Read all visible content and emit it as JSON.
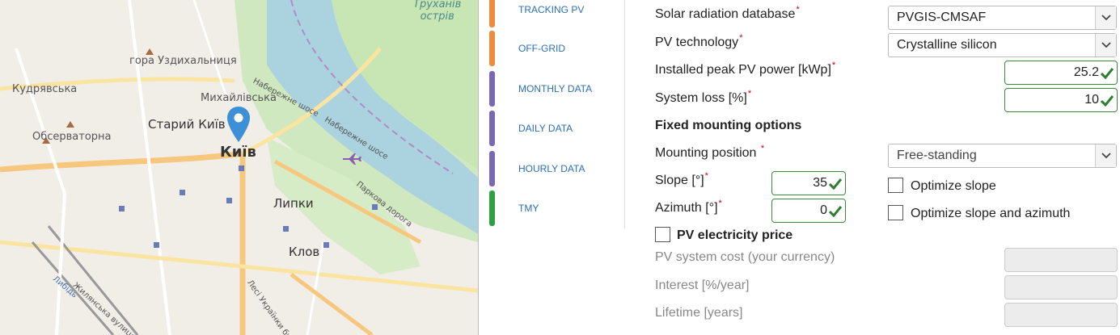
{
  "map": {
    "labels": {
      "trukhaniv": "Труханів\nострів",
      "uzdykhalnytsia": "гора Уздихальниця",
      "kudriavska": "Кудрявська",
      "mykhailivska": "Михайлівська",
      "naberezhne1": "Набережне шосе",
      "naberezhne2": "Набережне шосе",
      "staryi_kyiv": "Старий Київ",
      "observatorna": "Обсерваторна",
      "kyiv": "Київ",
      "lypky": "Липки",
      "parkova": "Паркова дорога",
      "klov": "Клов",
      "lybid": "Либідь",
      "zhylianska": "Жилянська вулиця",
      "lesi": "Лесі Українки бул."
    }
  },
  "tabs": [
    {
      "label": "TRACKING PV",
      "color": "#f08a3c"
    },
    {
      "label": "OFF-GRID",
      "color": "#f08a3c"
    },
    {
      "label": "MONTHLY DATA",
      "color": "#7b68b5"
    },
    {
      "label": "DAILY DATA",
      "color": "#7b68b5"
    },
    {
      "label": "HOURLY DATA",
      "color": "#7b68b5"
    },
    {
      "label": "TMY",
      "color": "#2ea043"
    }
  ],
  "form": {
    "required_mark": "*",
    "solar_db": {
      "label": "Solar radiation database",
      "value": "PVGIS-CMSAF"
    },
    "pv_tech": {
      "label": "PV technology",
      "value": "Crystalline silicon"
    },
    "peak_power": {
      "label": "Installed peak PV power [kWp]",
      "value": "25.2"
    },
    "system_loss": {
      "label": "System loss [%]",
      "value": "10"
    },
    "fixed_heading": "Fixed mounting options",
    "mounting": {
      "label": "Mounting position",
      "value": "Free-standing"
    },
    "slope": {
      "label": "Slope [°]",
      "value": "35"
    },
    "azimuth": {
      "label": "Azimuth [°]",
      "value": "0"
    },
    "optimize_slope": "Optimize slope",
    "optimize_slope_azimuth": "Optimize slope and azimuth",
    "pv_price": "PV electricity price",
    "pv_cost": "PV system cost (your currency)",
    "interest": "Interest [%/year]",
    "lifetime": "Lifetime [years]"
  },
  "colors": {
    "tab_text": "#2a6fb5",
    "valid_border": "#3a8a3a",
    "required": "#cc0000"
  }
}
